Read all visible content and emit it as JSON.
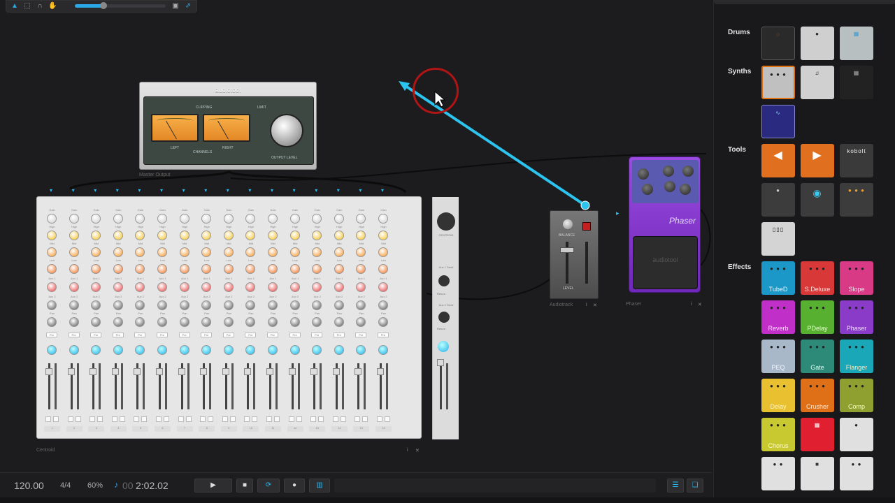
{
  "master_output": {
    "brand": "audiotool",
    "label": "Master Output",
    "clipping": "CLIPPING",
    "limit": "LIMIT",
    "left": "LEFT",
    "right": "RIGHT",
    "channels": "CHANNELS",
    "output_level": "OUTPUT LEVEL"
  },
  "mixer": {
    "label": "Centroid",
    "channels": [
      "1",
      "2",
      "3",
      "4",
      "5",
      "6",
      "7",
      "8",
      "9",
      "10",
      "11",
      "12",
      "13",
      "14",
      "15",
      "16"
    ],
    "pre_label": "Pre",
    "master_label": "CENTROID",
    "aux1": "Aux 1 Send",
    "aux2": "Aux 2 Send",
    "return": "Return",
    "knob_labels": [
      "Gain",
      "High",
      "Mid",
      "Low",
      "Aux 1",
      "Aux 2",
      "Pan"
    ]
  },
  "audiotrack": {
    "label": "Audiotrack",
    "balance": "BALANCE",
    "level": "LEVEL"
  },
  "phaser": {
    "label": "Phaser",
    "title": "Phaser",
    "brand": "audiotool"
  },
  "sidebar": {
    "categories": [
      {
        "name": "Drums"
      },
      {
        "name": "Synths"
      },
      {
        "name": "Tools"
      },
      {
        "name": "Effects"
      }
    ],
    "tools_text": "kobolt",
    "effects": [
      {
        "label": "TubeD",
        "bg": "#1b98c8",
        "fg": "#e8f8ff"
      },
      {
        "label": "S.Deluxe",
        "bg": "#d83838",
        "fg": "#ffe0e0"
      },
      {
        "label": "Slope",
        "bg": "#d83a86",
        "fg": "#ffe0f0"
      },
      {
        "label": "Reverb",
        "bg": "#c030c8",
        "fg": "#ffe0ff"
      },
      {
        "label": "PDelay",
        "bg": "#58b030",
        "fg": "#eaffd8"
      },
      {
        "label": "Phaser",
        "bg": "#8a3cc8",
        "fg": "#f0e0ff"
      },
      {
        "label": "PEQ",
        "bg": "#a8b8c8",
        "fg": "#eef6ff"
      },
      {
        "label": "Gate",
        "bg": "#2d8a78",
        "fg": "#d8fff4"
      },
      {
        "label": "Flanger",
        "bg": "#1aa8b8",
        "fg": "#ffe8c0"
      },
      {
        "label": "Delay",
        "bg": "#e8c030",
        "fg": "#fff4c0"
      },
      {
        "label": "Crusher",
        "bg": "#e07018",
        "fg": "#ffe8d0"
      },
      {
        "label": "Comp",
        "bg": "#90a030",
        "fg": "#f4ffc0"
      },
      {
        "label": "Chorus",
        "bg": "#c8c830",
        "fg": "#fffbd0"
      }
    ]
  },
  "transport": {
    "tempo": "120.00",
    "signature": "4/4",
    "zoom": "60%",
    "time_dim": "00",
    "time": "2:02.02",
    "play": "▶",
    "stop": "■"
  },
  "colors": {
    "cable": "#2cc4ee",
    "cursor_ring": "#b01414",
    "accent": "#2aa8e8"
  }
}
